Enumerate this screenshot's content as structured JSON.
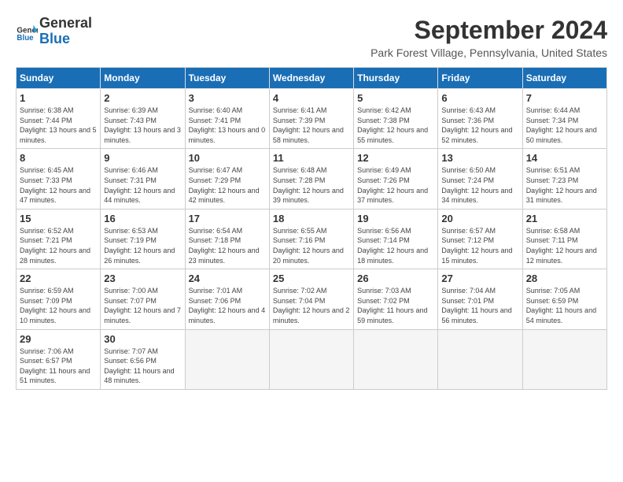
{
  "header": {
    "logo_line1": "General",
    "logo_line2": "Blue",
    "month": "September 2024",
    "location": "Park Forest Village, Pennsylvania, United States"
  },
  "days_of_week": [
    "Sunday",
    "Monday",
    "Tuesday",
    "Wednesday",
    "Thursday",
    "Friday",
    "Saturday"
  ],
  "weeks": [
    [
      {
        "day": "1",
        "sunrise": "6:38 AM",
        "sunset": "7:44 PM",
        "daylight": "13 hours and 5 minutes."
      },
      {
        "day": "2",
        "sunrise": "6:39 AM",
        "sunset": "7:43 PM",
        "daylight": "13 hours and 3 minutes."
      },
      {
        "day": "3",
        "sunrise": "6:40 AM",
        "sunset": "7:41 PM",
        "daylight": "13 hours and 0 minutes."
      },
      {
        "day": "4",
        "sunrise": "6:41 AM",
        "sunset": "7:39 PM",
        "daylight": "12 hours and 58 minutes."
      },
      {
        "day": "5",
        "sunrise": "6:42 AM",
        "sunset": "7:38 PM",
        "daylight": "12 hours and 55 minutes."
      },
      {
        "day": "6",
        "sunrise": "6:43 AM",
        "sunset": "7:36 PM",
        "daylight": "12 hours and 52 minutes."
      },
      {
        "day": "7",
        "sunrise": "6:44 AM",
        "sunset": "7:34 PM",
        "daylight": "12 hours and 50 minutes."
      }
    ],
    [
      {
        "day": "8",
        "sunrise": "6:45 AM",
        "sunset": "7:33 PM",
        "daylight": "12 hours and 47 minutes."
      },
      {
        "day": "9",
        "sunrise": "6:46 AM",
        "sunset": "7:31 PM",
        "daylight": "12 hours and 44 minutes."
      },
      {
        "day": "10",
        "sunrise": "6:47 AM",
        "sunset": "7:29 PM",
        "daylight": "12 hours and 42 minutes."
      },
      {
        "day": "11",
        "sunrise": "6:48 AM",
        "sunset": "7:28 PM",
        "daylight": "12 hours and 39 minutes."
      },
      {
        "day": "12",
        "sunrise": "6:49 AM",
        "sunset": "7:26 PM",
        "daylight": "12 hours and 37 minutes."
      },
      {
        "day": "13",
        "sunrise": "6:50 AM",
        "sunset": "7:24 PM",
        "daylight": "12 hours and 34 minutes."
      },
      {
        "day": "14",
        "sunrise": "6:51 AM",
        "sunset": "7:23 PM",
        "daylight": "12 hours and 31 minutes."
      }
    ],
    [
      {
        "day": "15",
        "sunrise": "6:52 AM",
        "sunset": "7:21 PM",
        "daylight": "12 hours and 28 minutes."
      },
      {
        "day": "16",
        "sunrise": "6:53 AM",
        "sunset": "7:19 PM",
        "daylight": "12 hours and 26 minutes."
      },
      {
        "day": "17",
        "sunrise": "6:54 AM",
        "sunset": "7:18 PM",
        "daylight": "12 hours and 23 minutes."
      },
      {
        "day": "18",
        "sunrise": "6:55 AM",
        "sunset": "7:16 PM",
        "daylight": "12 hours and 20 minutes."
      },
      {
        "day": "19",
        "sunrise": "6:56 AM",
        "sunset": "7:14 PM",
        "daylight": "12 hours and 18 minutes."
      },
      {
        "day": "20",
        "sunrise": "6:57 AM",
        "sunset": "7:12 PM",
        "daylight": "12 hours and 15 minutes."
      },
      {
        "day": "21",
        "sunrise": "6:58 AM",
        "sunset": "7:11 PM",
        "daylight": "12 hours and 12 minutes."
      }
    ],
    [
      {
        "day": "22",
        "sunrise": "6:59 AM",
        "sunset": "7:09 PM",
        "daylight": "12 hours and 10 minutes."
      },
      {
        "day": "23",
        "sunrise": "7:00 AM",
        "sunset": "7:07 PM",
        "daylight": "12 hours and 7 minutes."
      },
      {
        "day": "24",
        "sunrise": "7:01 AM",
        "sunset": "7:06 PM",
        "daylight": "12 hours and 4 minutes."
      },
      {
        "day": "25",
        "sunrise": "7:02 AM",
        "sunset": "7:04 PM",
        "daylight": "12 hours and 2 minutes."
      },
      {
        "day": "26",
        "sunrise": "7:03 AM",
        "sunset": "7:02 PM",
        "daylight": "11 hours and 59 minutes."
      },
      {
        "day": "27",
        "sunrise": "7:04 AM",
        "sunset": "7:01 PM",
        "daylight": "11 hours and 56 minutes."
      },
      {
        "day": "28",
        "sunrise": "7:05 AM",
        "sunset": "6:59 PM",
        "daylight": "11 hours and 54 minutes."
      }
    ],
    [
      {
        "day": "29",
        "sunrise": "7:06 AM",
        "sunset": "6:57 PM",
        "daylight": "11 hours and 51 minutes."
      },
      {
        "day": "30",
        "sunrise": "7:07 AM",
        "sunset": "6:56 PM",
        "daylight": "11 hours and 48 minutes."
      },
      null,
      null,
      null,
      null,
      null
    ]
  ]
}
